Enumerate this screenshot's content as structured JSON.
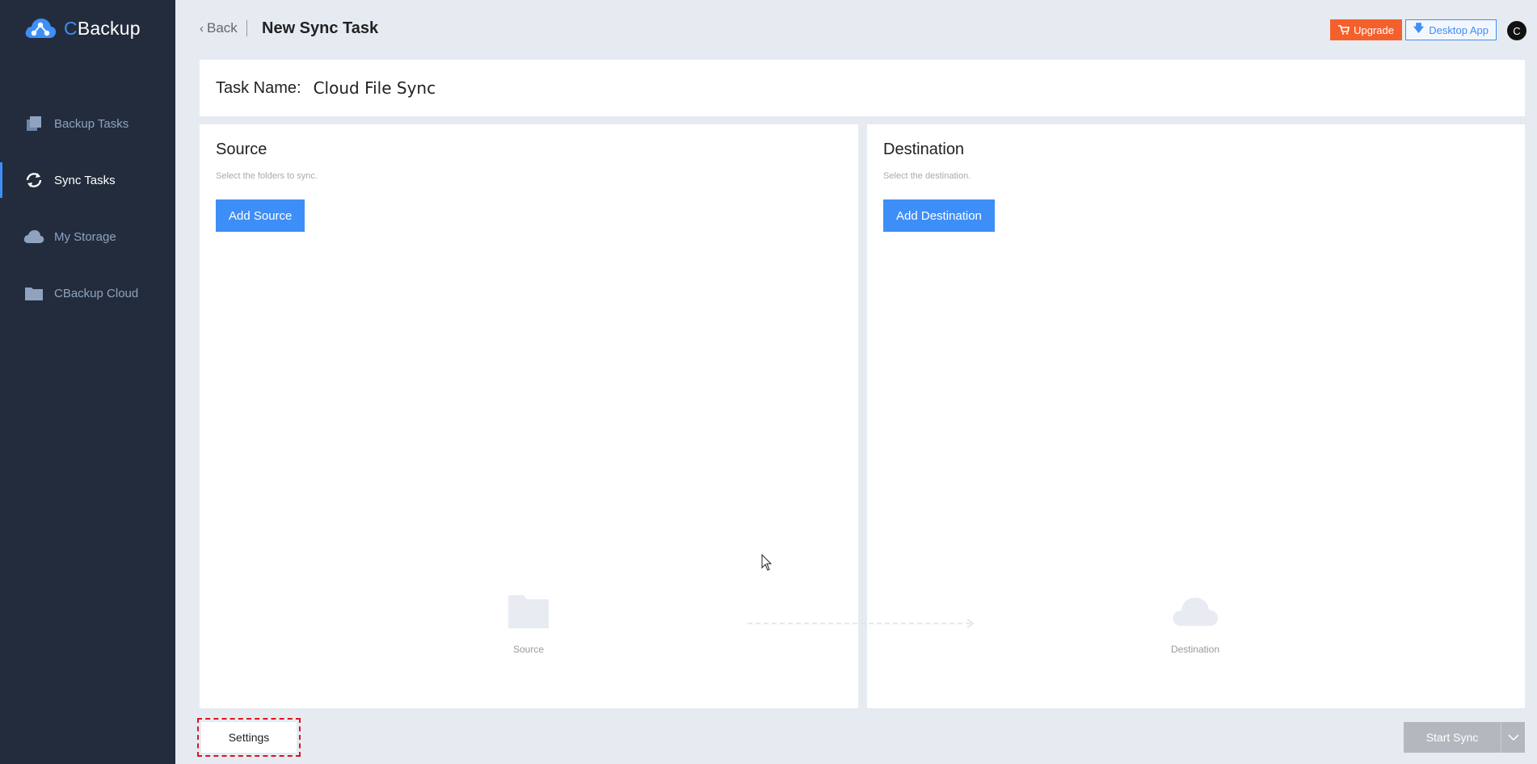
{
  "app": {
    "logo_c": "C",
    "logo_rest": "Backup",
    "logo_icon": "cloud-share-icon"
  },
  "sidebar": {
    "items": [
      {
        "label": "Backup Tasks",
        "icon": "copy-icon",
        "active": false
      },
      {
        "label": "Sync Tasks",
        "icon": "sync-icon",
        "active": true
      },
      {
        "label": "My Storage",
        "icon": "cloud-icon",
        "active": false
      },
      {
        "label": "CBackup Cloud",
        "icon": "folder-icon",
        "active": false
      }
    ]
  },
  "header": {
    "back_label": "Back",
    "title": "New Sync Task",
    "upgrade_label": "Upgrade",
    "desktop_label": "Desktop App",
    "avatar_initial": "C"
  },
  "task": {
    "name_label": "Task Name:",
    "name_value": "Cloud File Sync"
  },
  "source": {
    "title": "Source",
    "hint": "Select the folders to sync.",
    "button": "Add Source",
    "illustration_label": "Source"
  },
  "destination": {
    "title": "Destination",
    "hint": "Select the destination.",
    "button": "Add Destination",
    "illustration_label": "Destination"
  },
  "footer": {
    "settings_label": "Settings",
    "start_sync_label": "Start Sync"
  },
  "colors": {
    "sidebar_bg": "#222c3c",
    "accent": "#3e8ef7",
    "upgrade": "#f4602c",
    "highlight_dashed": "#e0141e",
    "disabled_button": "#b4b8be"
  }
}
